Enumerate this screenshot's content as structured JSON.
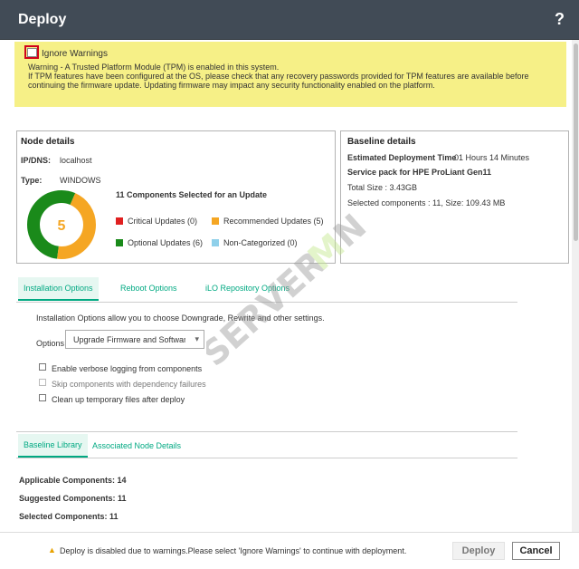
{
  "window": {
    "title": "Deploy",
    "help": "?"
  },
  "warning": {
    "checkbox_label": "Ignore Warnings",
    "line1": "Warning - A Trusted Platform Module (TPM) is enabled in this system.",
    "line2": "If TPM features have been configured at the OS, please check that any recovery passwords provided for TPM features are available before continuing the firmware update. Updating firmware may impact any security functionality enabled on the platform."
  },
  "node": {
    "heading": "Node details",
    "ip_label": "IP/DNS:",
    "ip_value": "localhost",
    "type_label": "Type:",
    "type_value": "WINDOWS",
    "components_selected": "11 Components Selected for an Update",
    "legend": {
      "critical": "Critical Updates (0)",
      "recommended": "Recommended Updates (5)",
      "optional": "Optional Updates (6)",
      "noncat": "Non-Categorized (0)"
    }
  },
  "chart_data": {
    "type": "pie",
    "center_label": "5",
    "series": [
      {
        "name": "Optional Updates",
        "value": 6,
        "color": "#1a8a1a"
      },
      {
        "name": "Recommended Updates",
        "value": 5,
        "color": "#f5a623"
      },
      {
        "name": "Critical Updates",
        "value": 0,
        "color": "#e02020"
      },
      {
        "name": "Non-Categorized",
        "value": 0,
        "color": "#8fd0ea"
      }
    ]
  },
  "baseline": {
    "heading": "Baseline details",
    "est_label": "Estimated Deployment Time",
    "est_value": "01 Hours 14 Minutes",
    "pack": "Service pack for HPE ProLiant Gen11",
    "total_size": "Total Size : 3.43GB",
    "selected": "Selected components : 11, Size: 109.43 MB"
  },
  "tabs": {
    "installation": "Installation Options",
    "reboot": "Reboot Options",
    "ilo": "iLO Repository Options"
  },
  "install": {
    "description": "Installation Options allow you to choose Downgrade, Rewrite and other settings.",
    "options_label": "Options",
    "options_value": "Upgrade Firmware and Software",
    "cb_verbose": "Enable verbose logging from components",
    "cb_skip": "Skip components with dependency failures",
    "cb_cleanup": "Clean up temporary files after deploy"
  },
  "tabs2": {
    "baseline_library": "Baseline Library",
    "associated": "Associated Node Details"
  },
  "counts": {
    "applicable": "Applicable Components: 14",
    "suggested": "Suggested Components: 11",
    "selected": "Selected Components: 11"
  },
  "footer": {
    "message": "Deploy is disabled due to warnings.Please select 'Ignore Warnings' to continue with deployment.",
    "deploy": "Deploy",
    "cancel": "Cancel"
  },
  "colors": {
    "accent": "#01a982",
    "warning_bg": "#f6f087",
    "titlebar": "#414b56"
  }
}
